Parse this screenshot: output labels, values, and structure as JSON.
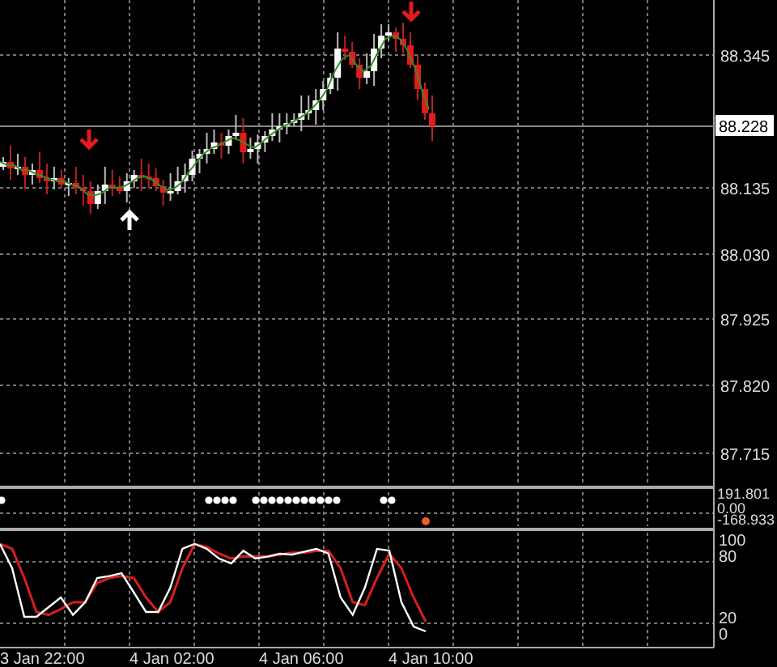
{
  "price_axis": {
    "ticks": [
      "88.345",
      "88.135",
      "88.030",
      "87.925",
      "87.820",
      "87.715"
    ],
    "current_price": "88.228"
  },
  "indicator_axis": {
    "ticks": [
      "191.801",
      "0.00",
      "-168.933"
    ]
  },
  "oscillator_axis": {
    "ticks": [
      "100",
      "80",
      "20",
      "0"
    ]
  },
  "time_axis": {
    "labels": [
      "3 Jan 22:00",
      "4 Jan 02:00",
      "4 Jan 06:00",
      "4 Jan 10:00"
    ]
  }
}
